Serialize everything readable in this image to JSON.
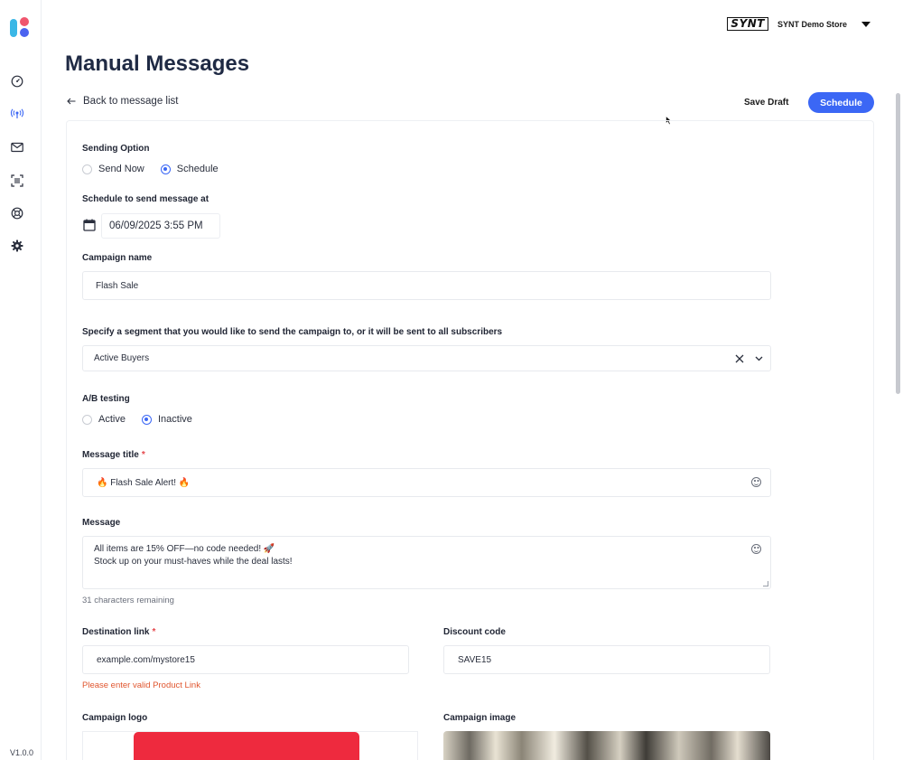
{
  "app": {
    "version": "V1.0.0",
    "nav": [
      "dashboard-icon",
      "broadcast-icon",
      "mail-icon",
      "scan-icon",
      "help-icon",
      "settings-icon"
    ]
  },
  "topbar": {
    "brand_logo_text": "SYNT",
    "store_name": "SYNT Demo Store"
  },
  "page": {
    "title": "Manual Messages",
    "back_label": "Back to message list",
    "save_draft_label": "Save Draft",
    "schedule_label": "Schedule"
  },
  "form": {
    "sending_option": {
      "label": "Sending Option",
      "options": [
        "Send Now",
        "Schedule"
      ],
      "selected": "Schedule"
    },
    "schedule_at": {
      "label": "Schedule to send message at",
      "value": "06/09/2025 3:55 PM"
    },
    "campaign_name": {
      "label": "Campaign name",
      "value": "Flash Sale"
    },
    "segment": {
      "label": "Specify a segment that you would like to send the campaign to, or it will be sent to all subscribers",
      "value": "Active Buyers"
    },
    "ab_testing": {
      "label": "A/B testing",
      "options": [
        "Active",
        "Inactive"
      ],
      "selected": "Inactive"
    },
    "message_title": {
      "label": "Message title",
      "required_mark": "*",
      "value": "🔥 Flash Sale Alert! 🔥"
    },
    "message": {
      "label": "Message",
      "line1": "All items are 15% OFF—no code needed! 🚀",
      "line2": "Stock up on your must-haves while the deal lasts!",
      "remaining": "31 characters remaining"
    },
    "destination_link": {
      "label": "Destination link",
      "required_mark": "*",
      "value": "example.com/mystore15",
      "error": "Please enter valid Product Link"
    },
    "discount_code": {
      "label": "Discount code",
      "value": "SAVE15"
    },
    "campaign_logo": {
      "label": "Campaign logo"
    },
    "campaign_image": {
      "label": "Campaign image"
    }
  },
  "colors": {
    "primary": "#3b67f5",
    "error": "#e0562f",
    "logo_red": "#ee2a3e"
  }
}
